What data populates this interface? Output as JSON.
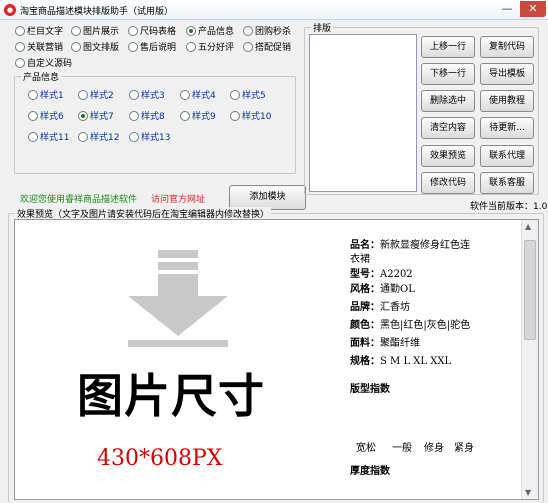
{
  "window": {
    "title": "淘宝商品描述模块排版助手（试用版）",
    "min_glyph": "—",
    "close_glyph": "✕"
  },
  "module_options": [
    {
      "label": "栏目文字",
      "checked": false
    },
    {
      "label": "图片展示",
      "checked": false
    },
    {
      "label": "尺码表格",
      "checked": false
    },
    {
      "label": "产品信息",
      "checked": true
    },
    {
      "label": "团购秒杀",
      "checked": false
    },
    {
      "label": "关联营销",
      "checked": false
    },
    {
      "label": "图文排版",
      "checked": false
    },
    {
      "label": "售后说明",
      "checked": false
    },
    {
      "label": "五分好评",
      "checked": false
    },
    {
      "label": "搭配促销",
      "checked": false
    },
    {
      "label": "自定义源码",
      "checked": false
    }
  ],
  "product_info": {
    "legend": "产品信息",
    "styles": [
      {
        "label": "样式1",
        "checked": false
      },
      {
        "label": "样式2",
        "checked": false
      },
      {
        "label": "样式3",
        "checked": false
      },
      {
        "label": "样式4",
        "checked": false
      },
      {
        "label": "样式5",
        "checked": false
      },
      {
        "label": "样式6",
        "checked": false
      },
      {
        "label": "样式7",
        "checked": true
      },
      {
        "label": "样式8",
        "checked": false
      },
      {
        "label": "样式9",
        "checked": false
      },
      {
        "label": "样式10",
        "checked": false
      },
      {
        "label": "样式11",
        "checked": false
      },
      {
        "label": "样式12",
        "checked": false
      },
      {
        "label": "样式13",
        "checked": false
      }
    ]
  },
  "welcome_text": "欢迎您使用睿祥商品描述软件",
  "official_link": "访问官方网址",
  "add_module_button": "添加模块",
  "layout_panel": {
    "legend": "排版",
    "buttons": [
      "上移一行",
      "复制代码",
      "下移一行",
      "导出模板",
      "删除选中",
      "使用教程",
      "清空内容",
      "待更新...",
      "效果预览",
      "联系代理",
      "修改代码",
      "联系客服"
    ]
  },
  "version_text": "软件当前版本：1.0",
  "preview": {
    "legend": "效果预览（文字及图片请安装代码后在淘宝编辑器内修改替换）",
    "image_caption": "图片尺寸",
    "image_size": "430*608PX",
    "fields": [
      {
        "key": "品名：",
        "value": "新款显瘦修身红色连"
      },
      {
        "key": "",
        "value": "衣裙"
      },
      {
        "key": "型号：",
        "value": "A2202"
      },
      {
        "key": "风格：",
        "value": "通勤OL"
      },
      {
        "key": "品牌：",
        "value": "汇香坊"
      },
      {
        "key": "颜色：",
        "value": "黑色|红色|灰色|驼色"
      },
      {
        "key": "面料：",
        "value": "聚酯纤维"
      },
      {
        "key": "规格：",
        "value": "S M L XL XXL"
      }
    ],
    "fit_title": "版型指数",
    "fit_levels": [
      "宽松",
      "一般",
      "修身",
      "紧身"
    ],
    "thickness_title": "厚度指数",
    "colors": {
      "accent_red": "#d40000",
      "welcome_green": "#1a8a1a",
      "link_red": "#e02020"
    }
  }
}
